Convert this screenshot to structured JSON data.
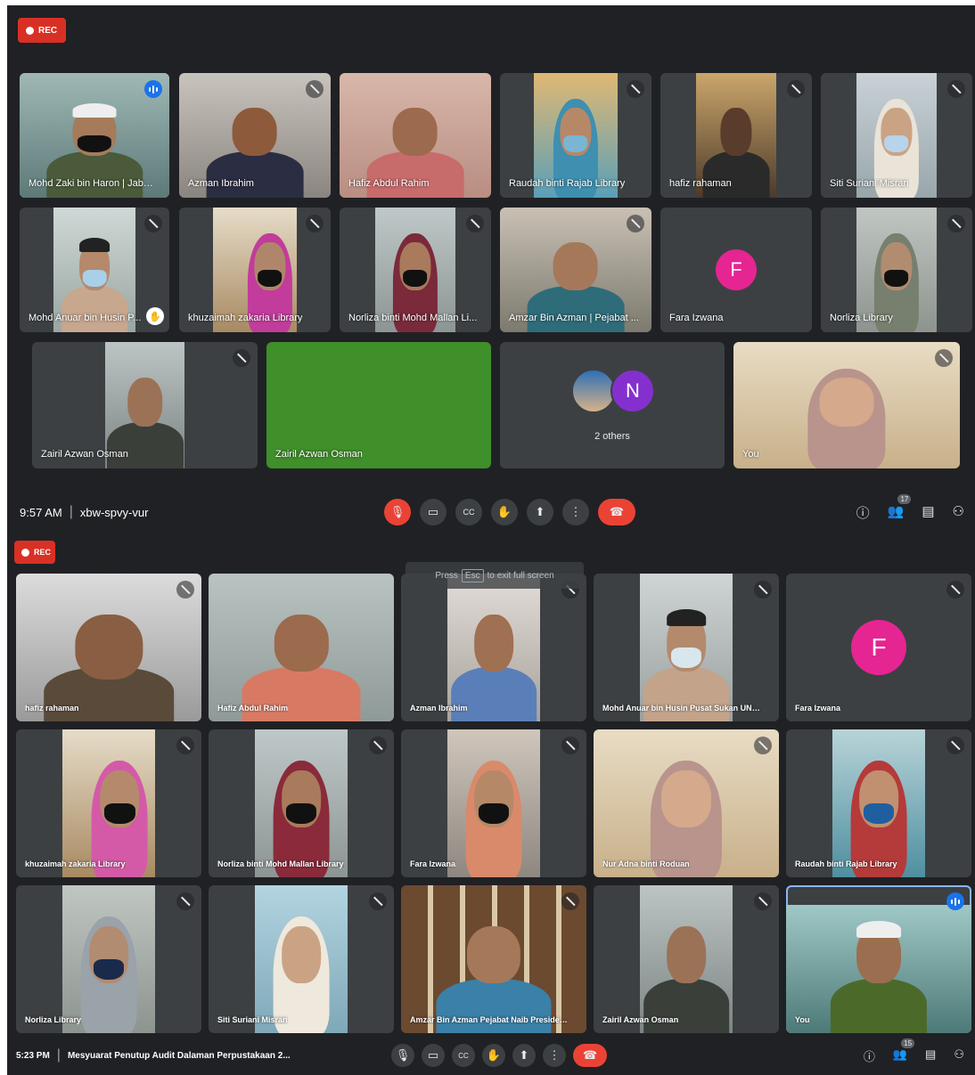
{
  "meeting1": {
    "rec_label": "REC",
    "time": "9:57 AM",
    "meeting_code": "xbw-spvy-vur",
    "participant_count": "17",
    "others_label": "2 others",
    "others_avatar_letter": "N",
    "tiles": [
      {
        "name": "Mohd Zaki bin Haron | Jabat..."
      },
      {
        "name": "Azman Ibrahim"
      },
      {
        "name": "Hafiz Abdul Rahim"
      },
      {
        "name": "Raudah binti Rajab Library"
      },
      {
        "name": "hafiz rahaman"
      },
      {
        "name": "Siti Suriani Misran"
      },
      {
        "name": "Mohd Anuar bin Husin P..."
      },
      {
        "name": "khuzaimah zakaria Library"
      },
      {
        "name": "Norliza binti Mohd Mallan Li..."
      },
      {
        "name": "Amzar Bin Azman | Pejabat ..."
      },
      {
        "name": "Fara Izwana",
        "avatar": "F"
      },
      {
        "name": "Norliza Library"
      },
      {
        "name": "Zairil Azwan Osman"
      },
      {
        "name": "Zairil Azwan Osman"
      },
      {
        "name": "You"
      }
    ]
  },
  "meeting2": {
    "rec_label": "REC",
    "time": "5:23 PM",
    "meeting_title": "Mesyuarat Penutup Audit Dalaman Perpustakaan 2...",
    "participant_count": "15",
    "toast": {
      "press": "Press",
      "key": "Esc",
      "rest": "to exit full screen"
    },
    "tiles": [
      {
        "name": "hafiz rahaman"
      },
      {
        "name": "Hafiz Abdul Rahim"
      },
      {
        "name": "Azman Ibrahim"
      },
      {
        "name": "Mohd Anuar bin Husin Pusat Sukan UNISEL"
      },
      {
        "name": "Fara Izwana",
        "avatar": "F"
      },
      {
        "name": "khuzaimah zakaria Library"
      },
      {
        "name": "Norliza binti Mohd Mallan Library"
      },
      {
        "name": "Fara Izwana"
      },
      {
        "name": "Nur Adna binti Roduan"
      },
      {
        "name": "Raudah binti Rajab Library"
      },
      {
        "name": "Norliza Library"
      },
      {
        "name": "Siti Suriani Misran"
      },
      {
        "name": "Amzar Bin Azman Pejabat Naib Presiden &..."
      },
      {
        "name": "Zairil Azwan Osman"
      },
      {
        "name": "You"
      }
    ]
  },
  "icons": {
    "mic": "🎙",
    "camera": "▭",
    "captions": "CC",
    "hand": "✋",
    "present": "⬆",
    "more": "⋮",
    "end_call": "☎",
    "info": "ⓘ",
    "people": "👥",
    "chat": "▤",
    "activities": "⚇"
  },
  "colors": {
    "accent": "#1a73e8",
    "danger": "#ea4335",
    "bg": "#202124",
    "tile": "#3c4043",
    "avatar_pink": "#e52592",
    "avatar_purple": "#8430ce"
  }
}
